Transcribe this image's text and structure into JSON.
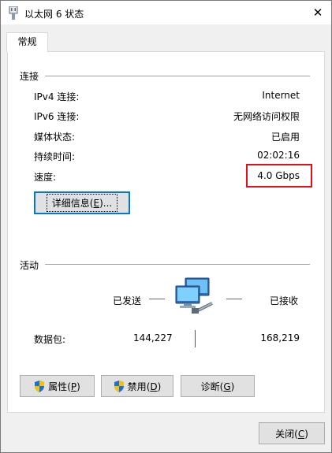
{
  "window": {
    "title": "以太网 6 状态",
    "close_glyph": "✕"
  },
  "tab": {
    "label": "常规"
  },
  "connection": {
    "heading": "连接",
    "rows": [
      {
        "label": "IPv4 连接:",
        "value": "Internet"
      },
      {
        "label": "IPv6 连接:",
        "value": "无网络访问权限"
      },
      {
        "label": "媒体状态:",
        "value": "已启用"
      },
      {
        "label": "持续时间:",
        "value": "02:02:16"
      },
      {
        "label": "速度:",
        "value": "4.0 Gbps"
      }
    ],
    "details_button": {
      "label": "详细信息",
      "accel": "E",
      "suffix": "..."
    }
  },
  "activity": {
    "heading": "活动",
    "sent_label": "已发送",
    "received_label": "已接收",
    "packets_label": "数据包:",
    "packets_sent": "144,227",
    "packets_received": "168,219"
  },
  "buttons": {
    "properties": {
      "label": "属性",
      "accel": "P"
    },
    "disable": {
      "label": "禁用",
      "accel": "D"
    },
    "diagnose": {
      "label": "诊断",
      "accel": "G"
    },
    "close": {
      "label": "关闭",
      "accel": "C"
    }
  },
  "colors": {
    "highlight": "#e1101a",
    "focus": "#0078d7",
    "shield_blue": "#1f6fd1",
    "shield_yellow": "#f4c20d"
  }
}
